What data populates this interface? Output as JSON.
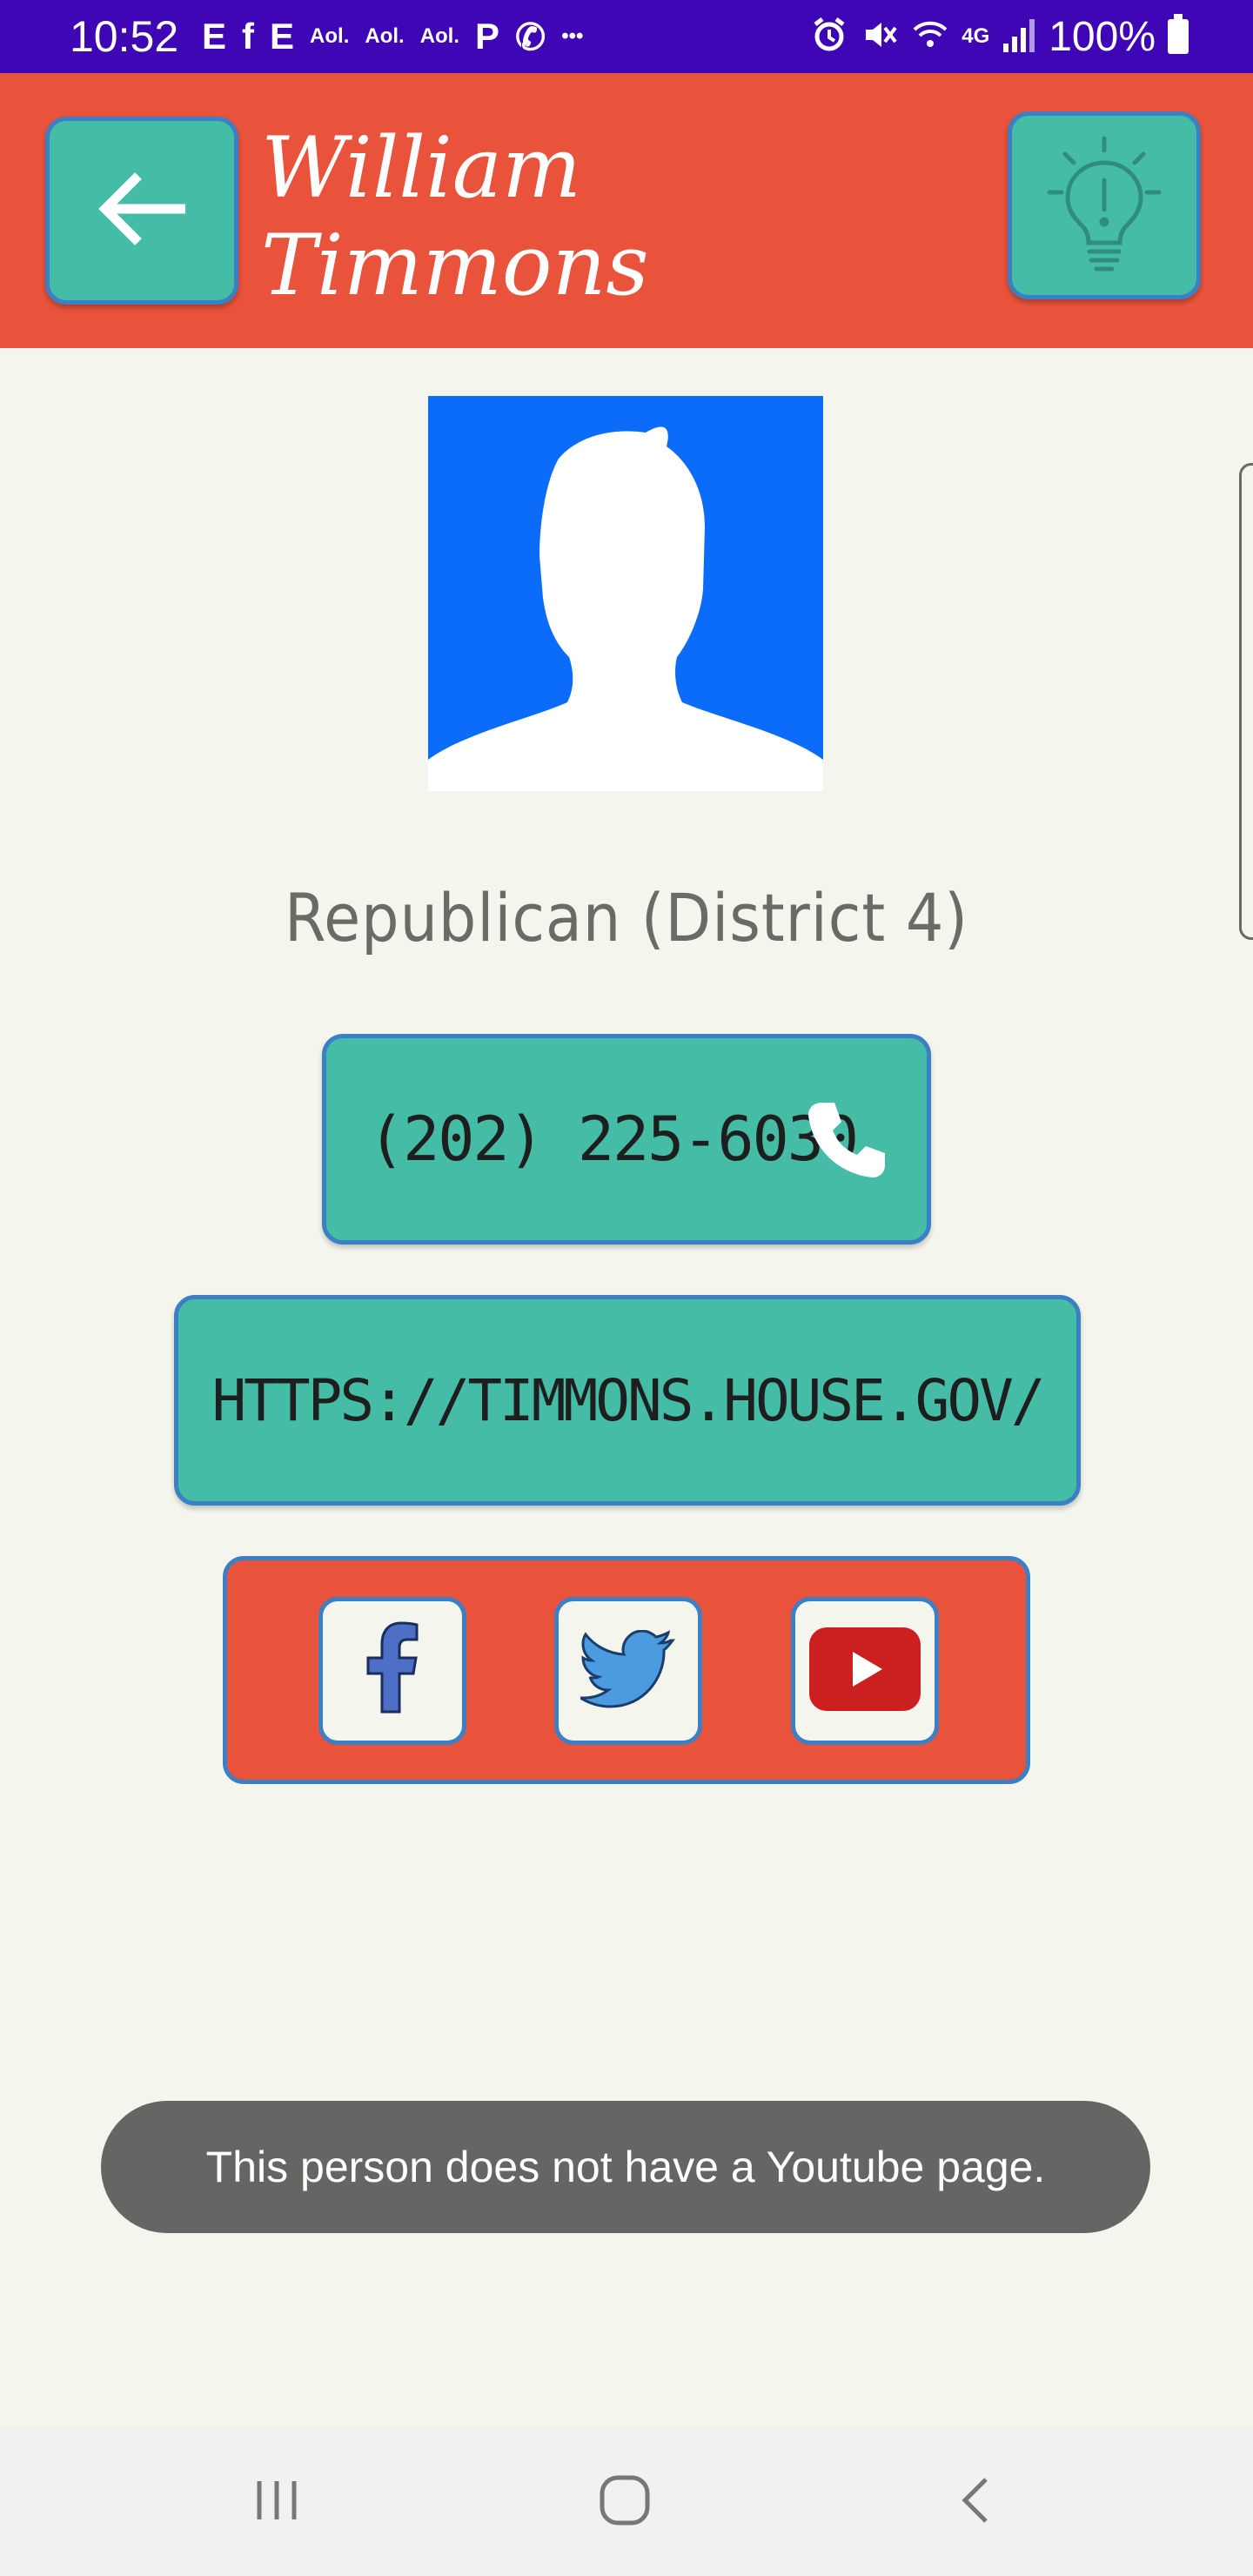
{
  "status_bar": {
    "time": "10:52",
    "icons_left": [
      {
        "name": "e-icon",
        "glyph": "E",
        "small": false
      },
      {
        "name": "facebook-status-icon",
        "glyph": "f",
        "small": false
      },
      {
        "name": "e2-icon",
        "glyph": "E",
        "small": false
      },
      {
        "name": "aol-icon",
        "glyph": "Aol.",
        "small": true
      },
      {
        "name": "aol2-icon",
        "glyph": "Aol.",
        "small": true
      },
      {
        "name": "aol3-icon",
        "glyph": "Aol.",
        "small": true
      },
      {
        "name": "p-icon",
        "glyph": "P",
        "small": false
      },
      {
        "name": "wifi-calling-icon",
        "glyph": "✆",
        "small": false
      },
      {
        "name": "more-icon",
        "glyph": "•••",
        "small": true
      }
    ],
    "battery_percent": "100%",
    "network_label": "4G"
  },
  "header": {
    "title": "William Timmons",
    "back_icon": "arrow-left-icon",
    "idea_icon": "lightbulb-icon"
  },
  "profile": {
    "party": "Republican (District 4)",
    "phone": "(202) 225-6030",
    "website": "HTTPS://TIMMONS.HOUSE.GOV/"
  },
  "social": {
    "facebook": "facebook-icon",
    "twitter": "twitter-icon",
    "youtube": "youtube-icon"
  },
  "toast": {
    "message": "This person does not have a Youtube page."
  },
  "colors": {
    "header": "#e9533b",
    "teal": "#45bda6",
    "border": "#3b7fc4",
    "background": "#f4f5ec",
    "status": "#3f06b6"
  }
}
